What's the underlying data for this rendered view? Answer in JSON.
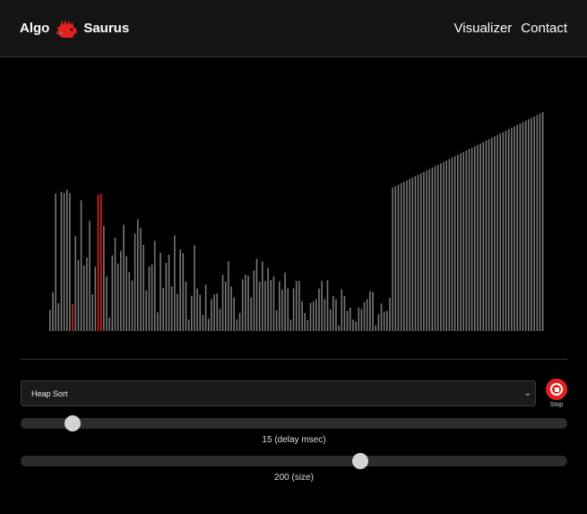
{
  "navbar": {
    "brand_left": "Algo",
    "brand_right": "Saurus",
    "links": [
      "Visualizer",
      "Contact"
    ]
  },
  "controls": {
    "algorithm": "Heap Sort",
    "stop_label": "Stop",
    "delay_caption": "15 (delay msec)",
    "delay_value": 15,
    "delay_fraction": 0.082,
    "size_caption": "200 (size)",
    "size_value": 200,
    "size_fraction": 0.625
  },
  "colors": {
    "bar": "#777777",
    "highlight": "#e32121",
    "accent": "#e32121"
  },
  "visualizer": {
    "bar_count": 175,
    "highlight_indices": [
      8,
      17,
      18
    ]
  }
}
